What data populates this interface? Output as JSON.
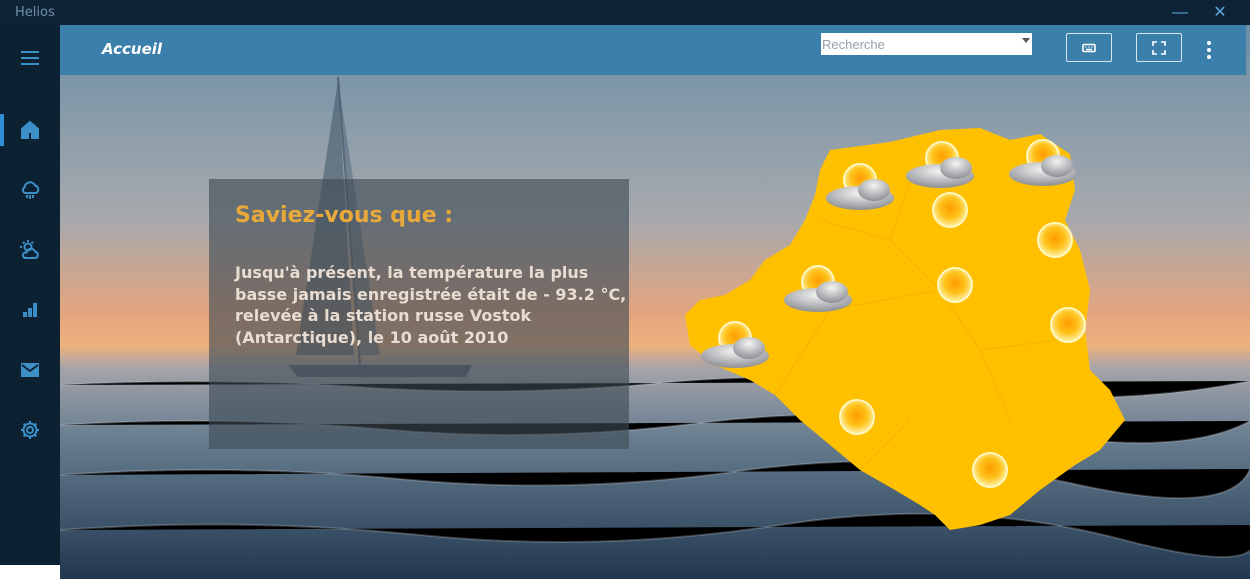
{
  "window": {
    "app_title": "Helios",
    "minimize_icon": "minimize-icon",
    "close_icon": "close-icon"
  },
  "sidebar": {
    "items": [
      {
        "name": "menu",
        "icon": "hamburger-menu-icon",
        "active": false
      },
      {
        "name": "home",
        "icon": "home-icon",
        "active": true
      },
      {
        "name": "cloud-rain",
        "icon": "cloud-rain-icon",
        "active": false
      },
      {
        "name": "weather",
        "icon": "sun-cloud-icon",
        "active": false
      },
      {
        "name": "stats",
        "icon": "bar-chart-icon",
        "active": false
      },
      {
        "name": "mail",
        "icon": "mail-icon",
        "active": false
      },
      {
        "name": "settings",
        "icon": "gear-icon",
        "active": false
      }
    ]
  },
  "header": {
    "title": "Accueil",
    "search_placeholder": "Recherche",
    "search_value": "",
    "keyboard_icon": "keyboard-icon",
    "fullscreen_icon": "fullscreen-icon",
    "more_icon": "more-vertical-icon"
  },
  "fact": {
    "title": "Saviez-vous que :",
    "text": "Jusqu'à présent, la température la plus basse jamais enregistrée était de - 93.2 °C, relevée à la station russe Vostok (Antarctique), le 10 août 2010"
  },
  "map": {
    "region_color": "#ffc000",
    "weather_icons": [
      "sun-cloud-icon",
      "sun-icon"
    ]
  },
  "colors": {
    "titlebar": "#0e2436",
    "sidebar": "#0c2233",
    "accent": "#3b7fab",
    "fact_title": "#e8a93a"
  }
}
